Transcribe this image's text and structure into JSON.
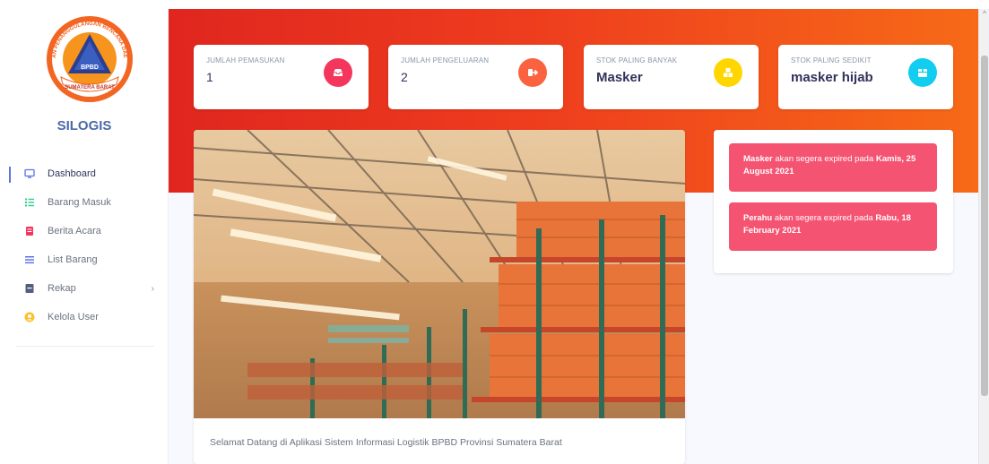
{
  "brand": {
    "name": "SILOGIS",
    "logo_ring_text": "BADAN PENANGGULANGAN BENCANA DAERAH",
    "logo_center": "BPBD",
    "logo_bottom": "SUMATERA BARAT"
  },
  "sidebar": {
    "items": [
      {
        "label": "Dashboard",
        "icon": "monitor-icon",
        "color": "#5e72e4"
      },
      {
        "label": "Barang Masuk",
        "icon": "list-icon",
        "color": "#2dce89"
      },
      {
        "label": "Berita Acara",
        "icon": "document-icon",
        "color": "#f5365c"
      },
      {
        "label": "List Barang",
        "icon": "bars-icon",
        "color": "#5e72e4"
      },
      {
        "label": "Rekap",
        "icon": "archive-icon",
        "color": "#525f7f"
      },
      {
        "label": "Kelola User",
        "icon": "user-icon",
        "color": "#fbc02d"
      }
    ],
    "rekap_chevron": "›"
  },
  "stats": [
    {
      "label": "JUMLAH PEMASUKAN",
      "value": "1",
      "icon": "inbox-icon",
      "color": "#f5365c"
    },
    {
      "label": "JUMLAH PENGELUARAN",
      "value": "2",
      "icon": "sign-out-icon",
      "color": "#fb6340"
    },
    {
      "label": "STOK PALING BANYAK",
      "value": "Masker",
      "icon": "boxes-icon",
      "color": "#ffd600"
    },
    {
      "label": "STOK PALING SEDIKIT",
      "value": "masker hijab",
      "icon": "box-icon",
      "color": "#11cdef"
    }
  ],
  "welcome_text": "Selamat Datang di Aplikasi Sistem Informasi Logistik BPBD Provinsi Sumatera Barat",
  "alerts": [
    {
      "item": "Masker",
      "middle": " akan segera expired pada ",
      "date": "Kamis, 25 August 2021"
    },
    {
      "item": "Perahu",
      "middle": " akan segera expired pada ",
      "date": "Rabu, 18 February 2021"
    }
  ],
  "colors": {
    "hero_start": "#e0261f",
    "hero_end": "#f76a17",
    "alert": "#f45372"
  }
}
